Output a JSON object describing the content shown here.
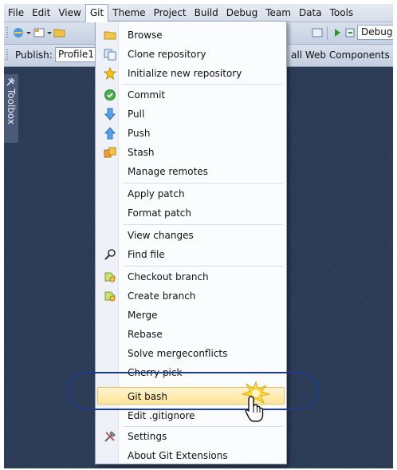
{
  "menubar": {
    "items": [
      "File",
      "Edit",
      "View",
      "Git",
      "Theme",
      "Project",
      "Build",
      "Debug",
      "Team",
      "Data",
      "Tools"
    ],
    "active": "Git"
  },
  "toolbar": {
    "config_value": "Debug"
  },
  "publish_bar": {
    "label": "Publish:",
    "profile_value": "Profile1",
    "web_components": "all Web Components"
  },
  "toolbox": {
    "label": "Toolbox"
  },
  "git_menu": {
    "items": [
      {
        "label": "Browse",
        "icon": "folder-icon"
      },
      {
        "label": "Clone repository",
        "icon": "clone-icon"
      },
      {
        "label": "Initialize new repository",
        "icon": "star-icon"
      },
      {
        "label": "Commit",
        "icon": "commit-check-icon"
      },
      {
        "label": "Pull",
        "icon": "pull-arrow-icon"
      },
      {
        "label": "Push",
        "icon": "push-arrow-icon"
      },
      {
        "label": "Stash",
        "icon": "stash-icon"
      },
      {
        "label": "Manage remotes",
        "icon": ""
      },
      {
        "label": "Apply patch",
        "icon": ""
      },
      {
        "label": "Format patch",
        "icon": ""
      },
      {
        "label": "View changes",
        "icon": ""
      },
      {
        "label": "Find file",
        "icon": "search-icon"
      },
      {
        "label": "Checkout branch",
        "icon": "branch-icon"
      },
      {
        "label": "Create branch",
        "icon": "branch-icon"
      },
      {
        "label": "Merge",
        "icon": ""
      },
      {
        "label": "Rebase",
        "icon": ""
      },
      {
        "label": "Solve mergeconflicts",
        "icon": ""
      },
      {
        "label": "Cherry pick",
        "icon": ""
      },
      {
        "label": "Git bash",
        "icon": ""
      },
      {
        "label": "Edit .gitignore",
        "icon": ""
      },
      {
        "label": "Settings",
        "icon": "tools-icon"
      },
      {
        "label": "About Git Extensions",
        "icon": ""
      }
    ],
    "highlighted": "Git bash"
  },
  "colors": {
    "highlight": "#ffe49a",
    "callout": "#1f3b8a",
    "background": "#2b3a55"
  }
}
